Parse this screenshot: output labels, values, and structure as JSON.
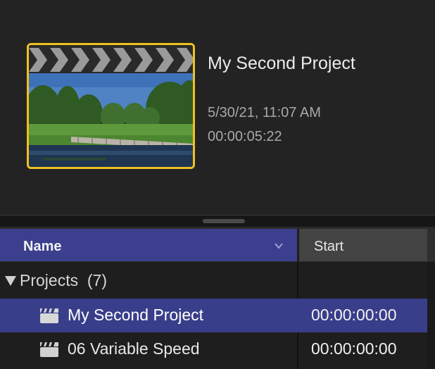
{
  "preview": {
    "title": "My Second Project",
    "date": "5/30/21, 11:07 AM",
    "duration": "00:00:05:22",
    "accent_color": "#f0c020"
  },
  "table": {
    "columns": {
      "name": "Name",
      "start": "Start"
    },
    "group": {
      "label": "Projects",
      "count": "(7)"
    },
    "rows": [
      {
        "name": "My Second Project",
        "start": "00:00:00:00",
        "selected": true,
        "icon": "clapperboard-icon"
      },
      {
        "name": "06 Variable Speed",
        "start": "00:00:00:00",
        "selected": false,
        "icon": "clapperboard-icon"
      }
    ],
    "selection_color": "#393e8a"
  }
}
